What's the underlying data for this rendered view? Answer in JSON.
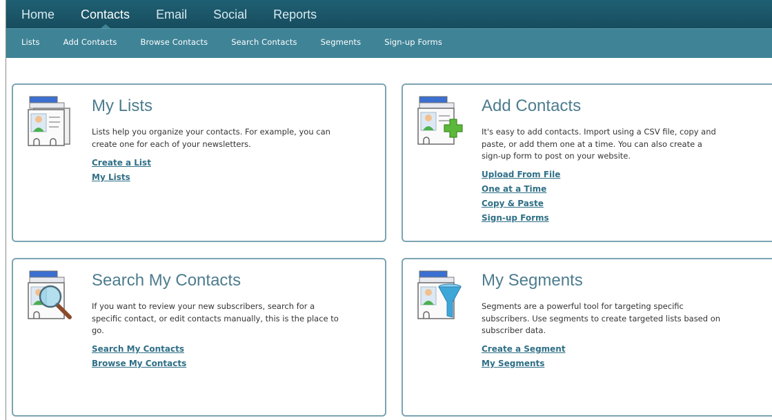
{
  "nav": {
    "tabs": [
      {
        "label": "Home"
      },
      {
        "label": "Contacts"
      },
      {
        "label": "Email"
      },
      {
        "label": "Social"
      },
      {
        "label": "Reports"
      }
    ],
    "active_tab": "Contacts",
    "subnav": [
      {
        "label": "Lists"
      },
      {
        "label": "Add Contacts"
      },
      {
        "label": "Browse Contacts"
      },
      {
        "label": "Search Contacts"
      },
      {
        "label": "Segments"
      },
      {
        "label": "Sign-up Forms"
      }
    ]
  },
  "cards": {
    "lists": {
      "title": "My Lists",
      "description_lines": [
        "Lists help you organize your contacts. For example, you can",
        "create one for each of your newsletters."
      ],
      "links": [
        "Create a List",
        "My Lists"
      ],
      "icon": "contact-cards-icon"
    },
    "add": {
      "title": "Add Contacts",
      "description_lines": [
        "It's easy to add contacts. Import using a CSV file, copy and",
        "paste, or add them one at a time. You can also create a",
        "sign-up form to post on your website."
      ],
      "links": [
        "Upload From File",
        "One at a Time",
        "Copy & Paste",
        "Sign-up Forms"
      ],
      "icon": "add-contact-plus-icon"
    },
    "search": {
      "title": "Search My Contacts",
      "description_lines": [
        "If you want to review your new subscribers, search for a",
        "specific contact, or edit contacts manually, this is the place to",
        "go."
      ],
      "links": [
        "Search My Contacts",
        "Browse My Contacts"
      ],
      "icon": "contact-search-magnifier-icon"
    },
    "segments": {
      "title": "My Segments",
      "description_lines": [
        "Segments are a powerful tool for targeting specific",
        "subscribers. Use segments to create targeted lists based on",
        "subscriber data."
      ],
      "links": [
        "Create a Segment",
        "My Segments"
      ],
      "icon": "contact-filter-funnel-icon"
    }
  },
  "colors": {
    "nav_dark": "#1f5f73",
    "nav_sub": "#3f8396",
    "card_border": "#7ba3b2",
    "title": "#4d7c8e",
    "link": "#2f6f86",
    "plus_green": "#5cb83a",
    "funnel_blue": "#3fa7d8"
  }
}
